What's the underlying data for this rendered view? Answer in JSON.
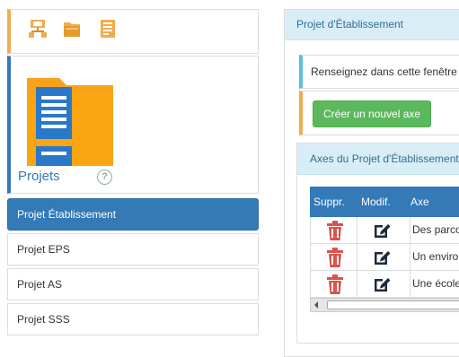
{
  "header": {
    "title": "Projet d'Établissement"
  },
  "info": {
    "text": "Renseignez dans cette fenêtre"
  },
  "actions": {
    "create_axis": "Créer un nouvel axe"
  },
  "axes_panel": {
    "title": "Axes du Projet d'Établissement"
  },
  "table": {
    "columns": [
      "Suppr.",
      "Modif.",
      "Axe"
    ],
    "rows": [
      {
        "axe": "Des parcours"
      },
      {
        "axe": "Un environnement"
      },
      {
        "axe": "Une école"
      }
    ]
  },
  "tile": {
    "title": "Projets",
    "help": "?"
  },
  "sidebar": {
    "items": [
      {
        "label": "Projet Établissement",
        "active": true
      },
      {
        "label": "Projet EPS"
      },
      {
        "label": "Projet AS"
      },
      {
        "label": "Projet SSS"
      }
    ]
  },
  "icons": {
    "strip": [
      "org-chart-icon",
      "folder-icon",
      "document-folder-icon"
    ],
    "tile": "project-folder-icon",
    "help": "help-circle-icon",
    "delete": "trash-icon",
    "edit": "edit-icon"
  },
  "colors": {
    "primary": "#337ab7",
    "info_bg": "#d9edf7",
    "success": "#5cb85c",
    "warning": "#f0ad4e",
    "danger": "#d9534f"
  }
}
